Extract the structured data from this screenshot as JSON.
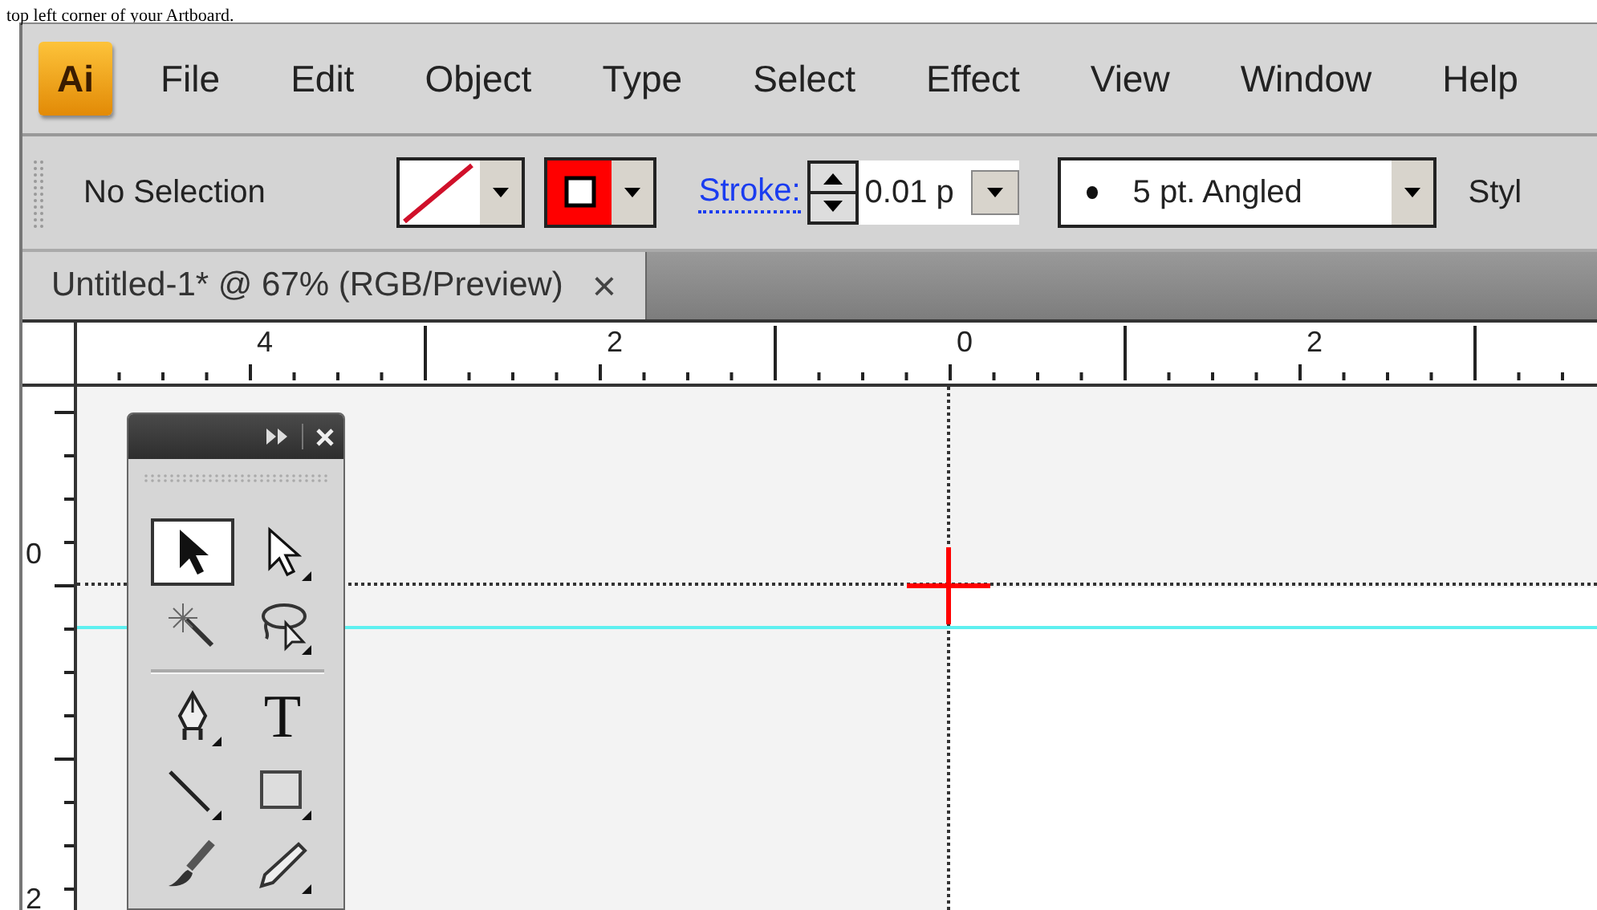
{
  "caption": "top left corner of your Artboard.",
  "app": {
    "logo": "Ai"
  },
  "menu": [
    "File",
    "Edit",
    "Object",
    "Type",
    "Select",
    "Effect",
    "View",
    "Window",
    "Help"
  ],
  "control_bar": {
    "selection": "No Selection",
    "stroke_label": "Stroke:",
    "stroke_weight": "0.01 p",
    "brush": "5 pt. Angled",
    "style_label": "Styl"
  },
  "document_tab": {
    "title": "Untitled-1* @ 67% (RGB/Preview)",
    "close": "×"
  },
  "rulers": {
    "horizontal": [
      "4",
      "2",
      "0",
      "2"
    ],
    "vertical": [
      "0",
      "2"
    ]
  },
  "tools_panel": {
    "tools": [
      {
        "selected": true
      },
      {
        "selected": false
      },
      {
        "selected": false
      },
      {
        "selected": false
      },
      {
        "selected": false
      },
      {
        "glyph": "T",
        "selected": false
      },
      {
        "selected": false
      },
      {
        "selected": false
      },
      {
        "selected": false
      },
      {
        "selected": false
      }
    ]
  }
}
